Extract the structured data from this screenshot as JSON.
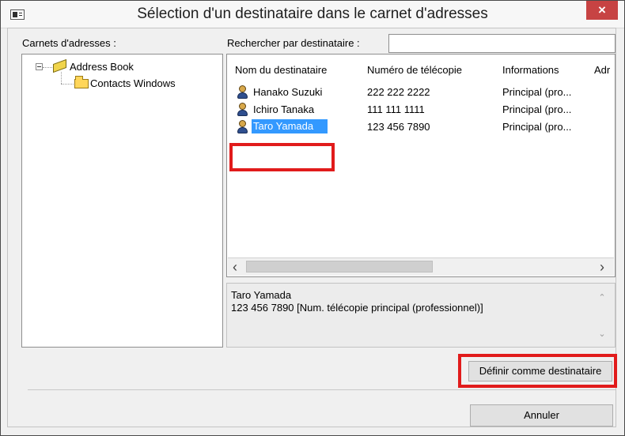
{
  "window": {
    "title": "Sélection d'un destinataire dans le carnet d'adresses",
    "close_glyph": "×"
  },
  "address_books": {
    "label": "Carnets d'adresses :",
    "tree": [
      {
        "label": "Address Book",
        "icon": "address-book-icon",
        "expanded": true,
        "expand_glyph": "⊟"
      },
      {
        "label": "Contacts Windows",
        "icon": "folder-icon"
      }
    ]
  },
  "search": {
    "label": "Rechercher par destinataire :",
    "value": ""
  },
  "recipients": {
    "columns": [
      "Nom du destinataire",
      "Numéro de télécopie",
      "Informations",
      "Adr"
    ],
    "rows": [
      {
        "name": "Hanako Suzuki",
        "fax": "222 222 2222",
        "info": "Principal (pro..."
      },
      {
        "name": "Ichiro Tanaka",
        "fax": "111 111 1111",
        "info": "Principal (pro..."
      },
      {
        "name": "Taro Yamada",
        "fax": "123 456 7890",
        "info": "Principal (pro...",
        "selected": true
      }
    ]
  },
  "details": {
    "name": "Taro Yamada",
    "line": "123 456 7890 [Num. télécopie principal (professionnel)]"
  },
  "buttons": {
    "set_recipient": "Définir comme destinataire",
    "cancel": "Annuler"
  },
  "colors": {
    "highlight_red": "#e11b1b",
    "selection_blue": "#3399ff",
    "close_red": "#c74343"
  }
}
